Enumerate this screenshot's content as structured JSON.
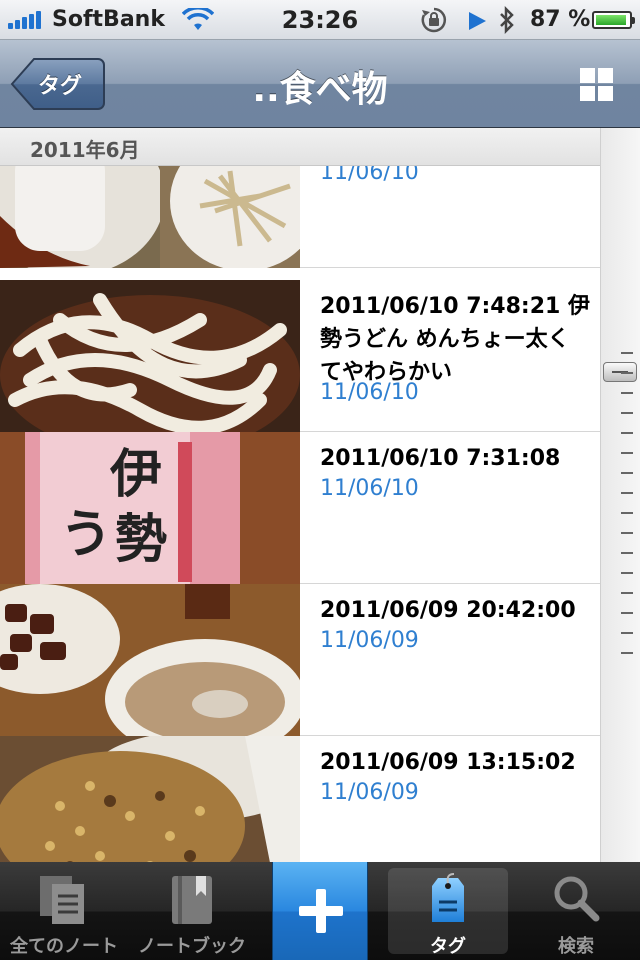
{
  "status_bar": {
    "carrier": "SoftBank",
    "time": "23:26",
    "battery_percent": "87 %",
    "battery_level": 0.87,
    "icons": [
      "signal-icon",
      "wifi-icon",
      "rotation-lock-icon",
      "location-icon",
      "bluetooth-icon",
      "battery-icon"
    ]
  },
  "nav": {
    "back_label": "タグ",
    "title": "..食べ物",
    "grid_icon": "grid-icon"
  },
  "section": {
    "label": "2011年6月"
  },
  "notes": [
    {
      "title": "",
      "date": "11/06/10",
      "thumb": "rice-cake-and-cabbage"
    },
    {
      "title": "2011/06/10 7:48:21 伊勢うどん めんちょー太くてやわらかい",
      "date": "11/06/10",
      "thumb": "udon-noodles"
    },
    {
      "title": "2011/06/10 7:31:08",
      "date": "11/06/10",
      "thumb": "ise-udon-package"
    },
    {
      "title": "2011/06/09 20:42:00",
      "date": "11/06/09",
      "thumb": "meat-and-dumpling-soup"
    },
    {
      "title": "2011/06/09 13:15:02",
      "date": "11/06/09",
      "thumb": "fried-rice"
    }
  ],
  "tabs": [
    {
      "label": "全てのノート",
      "icon": "all-notes-icon",
      "selected": false
    },
    {
      "label": "ノートブック",
      "icon": "notebook-icon",
      "selected": false
    },
    {
      "label": "",
      "icon": "plus-icon",
      "selected": false
    },
    {
      "label": "タグ",
      "icon": "tag-icon",
      "selected": true
    },
    {
      "label": "検索",
      "icon": "search-icon",
      "selected": false
    }
  ],
  "colors": {
    "nav_bar": "#8e9fb5",
    "date_text": "#2f7fd0",
    "add_button": "#2a87df",
    "tab_bar": "#1a1a1a"
  }
}
